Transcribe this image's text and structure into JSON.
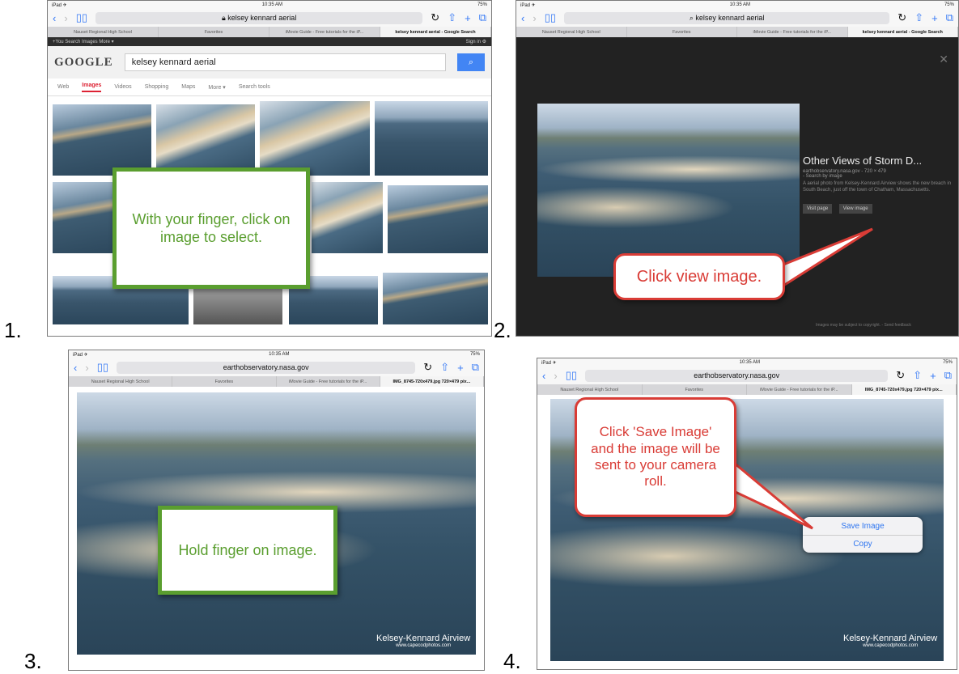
{
  "steps": [
    "1.",
    "2.",
    "3.",
    "4."
  ],
  "browser": {
    "status_left": "iPad ✈",
    "time": "10:35 AM",
    "battery": "75%",
    "tabs_common": [
      "Nauset Regional High School",
      "Favorites",
      "iMovie Guide - Free tutorials for the iP..."
    ],
    "panel1": {
      "url": "kelsey kennard aerial",
      "active_tab": "kelsey kennard aerial - Google Search"
    },
    "panel2": {
      "url": "kelsey kennard aerial",
      "active_tab": "kelsey kennard aerial - Google Search"
    },
    "panel3": {
      "url": "earthobservatory.nasa.gov",
      "active_tab": "IMG_8745-720x479.jpg 720×479 pix..."
    },
    "panel4": {
      "url": "earthobservatory.nasa.gov",
      "active_tab": "IMG_8745-720x479.jpg 720×479 pix..."
    }
  },
  "google": {
    "topbar_left": "+You  Search  Images  More ▾",
    "signin": "Sign in",
    "logo": "GOOGLE",
    "query": "kelsey kennard aerial",
    "nav": [
      "Web",
      "Images",
      "Videos",
      "Shopping",
      "Maps",
      "More ▾",
      "Search tools"
    ]
  },
  "preview": {
    "title": "Other Views of Storm D...",
    "source": "earthobservatory.nasa.gov - 720 × 479",
    "search_by": "- Search by image",
    "desc": "A aerial photo from Kelsey-Kennard Airview shows the new breach in South Beach, just off the town of Chatham, Massachusetts.",
    "visit_btn": "Visit page",
    "view_btn": "View image",
    "footer": "Images may be subject to copyright.  -  Send feedback"
  },
  "callouts": {
    "c1": "With your finger, click on image to select.",
    "c2": "Click view image.",
    "c3": "Hold finger on image.",
    "c4": "Click 'Save Image' and the image will be sent to your camera roll."
  },
  "menu": {
    "save": "Save Image",
    "copy": "Copy"
  },
  "watermark": {
    "title": "Kelsey-Kennard Airview",
    "site": "www.capecodphotos.com"
  },
  "icons": [
    "back-icon",
    "forward-icon",
    "bookmarks-icon",
    "reload-icon",
    "share-icon",
    "plus-icon",
    "tabs-icon",
    "lock-icon",
    "gear-icon",
    "search-icon",
    "close-icon"
  ]
}
